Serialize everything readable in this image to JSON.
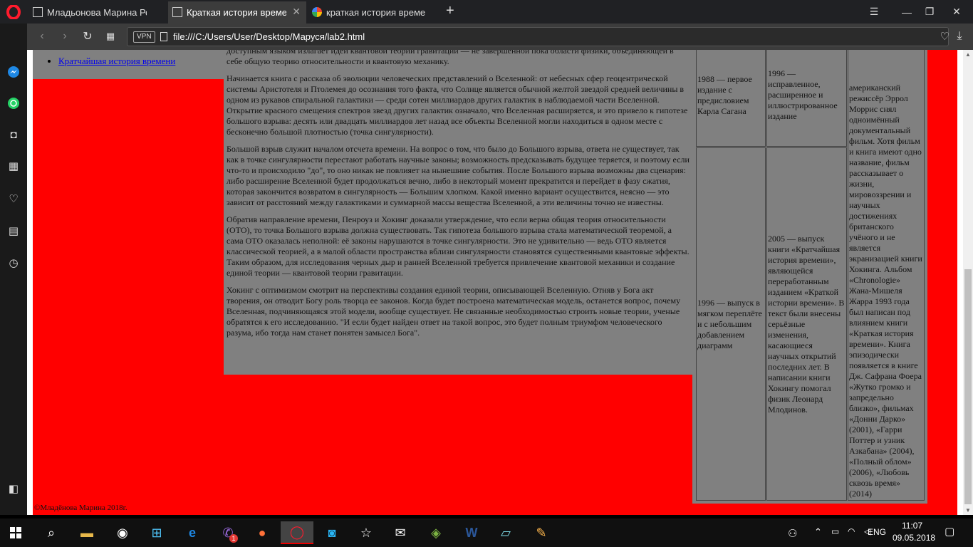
{
  "browser": {
    "tabs": [
      {
        "label": "Младьонова Марина Рез",
        "active": false
      },
      {
        "label": "Краткая история времени",
        "active": true
      },
      {
        "label": "краткая история времени",
        "active": false
      }
    ],
    "url": "file:///C:/Users/User/Desktop/Маруся/lab2.html",
    "vpn_label": "VPN"
  },
  "page": {
    "nav": {
      "link": "Кратчайшая история времени"
    },
    "article": [
      "доступным языком излагает идеи квантовой теории гравитации — не завершенной пока области физики, объединяющей в себе общую теорию относительности и квантовую механику.",
      "Начинается книга с рассказа об эволюции человеческих представлений о Вселенной: от небесных сфер геоцентрической системы Аристотеля и Птолемея до осознания того факта, что Солнце является обычной желтой звездой средней величины в одном из рукавов спиральной галактики — среди сотен миллиардов других галактик в наблюдаемой части Вселенной. Открытие красного смещения спектров звезд других галактик означало, что Вселенная расширяется, и это привело к гипотезе большого взрыва: десять или двадцать миллиардов лет назад все объекты Вселенной могли находиться в одном месте с бесконечно большой плотностью (точка сингулярности).",
      "Большой взрыв служит началом отсчета времени. На вопрос о том, что было до Большого взрыва, ответа не существует, так как в точке сингулярности перестают работать научные законы; возможность предсказывать будущее теряется, и поэтому если что-то и происходило \"до\", то оно никак не повлияет на нынешние события. После Большого взрыва возможны два сценария: либо расширение Вселенной будет продолжаться вечно, либо в некоторый момент прекратится и перейдет в фазу сжатия, которая закончится возвратом в сингулярность — Большим хлопком. Какой именно вариант осуществится, неясно — это зависит от расстояний между галактиками и суммарной массы вещества Вселенной, а эти величины точно не известны.",
      "Обратив направление времени, Пенроуз и Хокинг доказали утверждение, что если верна общая теория относительности (ОТО), то точка Большого взрыва должна существовать. Так гипотеза большого взрыва стала математической теоремой, а сама ОТО оказалась неполной: её законы нарушаются в точке сингулярности. Это не удивительно — ведь ОТО является классической теорией, а в малой области пространства вблизи сингулярности становятся существенными квантовые эффекты. Таким образом, для исследования черных дыр и ранней Вселенной требуется привлечение квантовой механики и создание единой теории — квантовой теории гравитации.",
      "Хокинг с оптимизмом смотрит на перспективы создания единой теории, описывающей Вселенную. Отняв у Бога акт творения, он отводит Богу роль творца ее законов. Когда будет построена математическая модель, останется вопрос, почему Вселенная, подчиняющаяся этой модели, вообще существует. Не связанные необходимостью строить новые теории, ученые обратятся к его исследованию. \"И если будет найден ответ на такой вопрос, это будет полным триумфом человеческого разума, ибо тогда нам станет понятен замысел Бога\"."
    ],
    "table": {
      "r1c1": "1988 — первое издание с предисловием Карла Сагана",
      "r1c2": "1996 — исправленное, расширенное и иллюстрированное издание",
      "r2c1": "1996 — выпуск в мягком переплёте и с небольшим добавлением диаграмм",
      "r2c2": "2005 — выпуск книги «Кратчайшая история времени», являющейся переработанным изданием «Краткой истории времени». В текст были внесены серьёзные изменения, касающиеся научных открытий последних лет. В написании книги Хокингу помогал физик Леонард Млодинов.",
      "c3": "американский режиссёр Эррол Моррис снял одноимённый документальный фильм. Хотя фильм и книга имеют одно название, фильм рассказывает о жизни, мировоззрении и научных достижениях британского учёного и не является экранизацией книги Хокинга. Альбом «Chronologie» Жана-Мишеля Жарра 1993 года был написан под влиянием книги «Краткая история времени». Книга эпизодически появляется в книге Дж. Сафрана Фоера «Жутко громко и запредельно близко», фильмах «Донни Дарко» (2001), «Гарри Поттер и узник Азкабана» (2004), «Полный облом» (2006), «Любовь сквозь время» (2014)"
    },
    "footer": "©Младёнова Марина 2018г."
  },
  "taskbar": {
    "lang": "ENG",
    "time": "11:07",
    "date": "09.05.2018",
    "viber_badge": "1"
  },
  "colors": {
    "page_bg": "#ff0000",
    "block_bg": "#808080"
  }
}
